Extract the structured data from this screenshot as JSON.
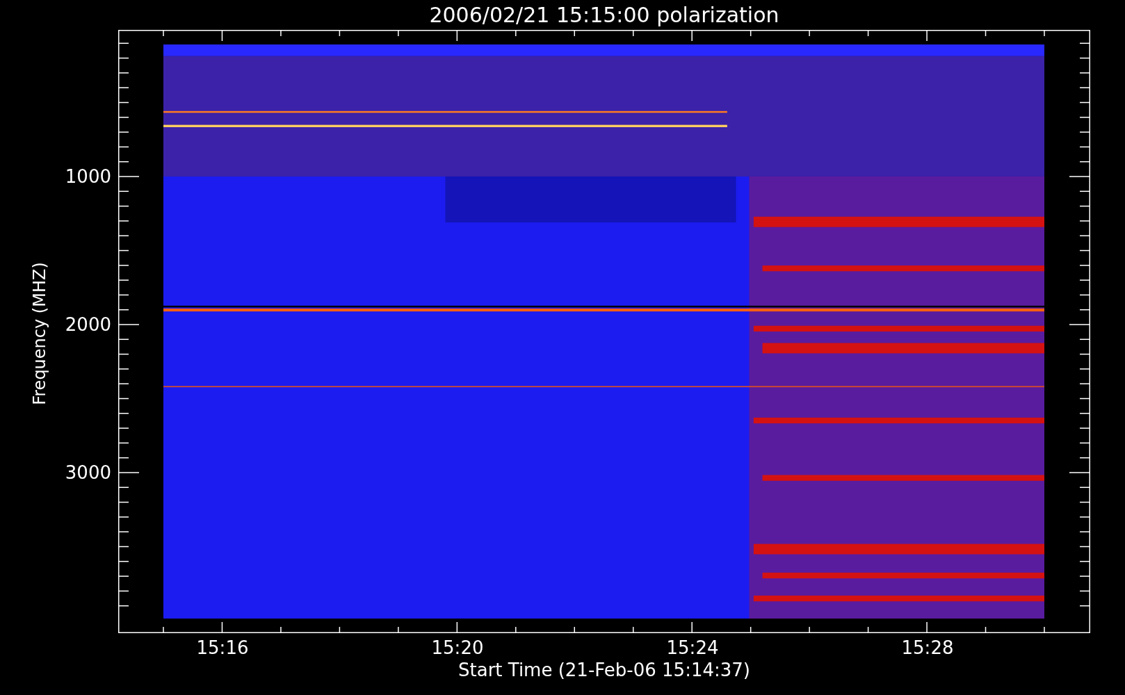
{
  "title": "2006/02/21 15:15:00 polarization",
  "y_axis": {
    "label": "Frequency (MHZ)",
    "ticks": [
      "1000",
      "2000",
      "3000"
    ]
  },
  "x_axis": {
    "label": "Start Time (21-Feb-06 15:14:37)",
    "ticks": [
      "15:16",
      "15:20",
      "15:24",
      "15:28"
    ]
  }
}
